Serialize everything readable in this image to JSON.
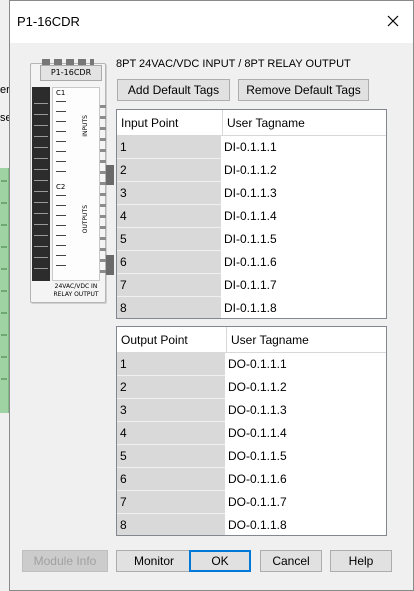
{
  "background": {
    "text1": "er",
    "text2": "se"
  },
  "dialog": {
    "title": "P1-16CDR"
  },
  "module_image": {
    "model": "P1-16CDR",
    "c1": "C1",
    "c2": "C2",
    "inputs_label": "INPUTS",
    "outputs_label": "OUTPUTS",
    "footer": "24VAC/VDC IN RELAY OUTPUT"
  },
  "description": "8PT 24VAC/VDC INPUT / 8PT RELAY OUTPUT",
  "toolbar": {
    "add_default_tags": "Add Default Tags",
    "remove_default_tags": "Remove Default Tags"
  },
  "input_table": {
    "headers": [
      "Input Point",
      "User Tagname"
    ],
    "rows": [
      [
        "1",
        "DI-0.1.1.1"
      ],
      [
        "2",
        "DI-0.1.1.2"
      ],
      [
        "3",
        "DI-0.1.1.3"
      ],
      [
        "4",
        "DI-0.1.1.4"
      ],
      [
        "5",
        "DI-0.1.1.5"
      ],
      [
        "6",
        "DI-0.1.1.6"
      ],
      [
        "7",
        "DI-0.1.1.7"
      ],
      [
        "8",
        "DI-0.1.1.8"
      ]
    ]
  },
  "output_table": {
    "headers": [
      "Output Point",
      "User Tagname"
    ],
    "rows": [
      [
        "1",
        "DO-0.1.1.1"
      ],
      [
        "2",
        "DO-0.1.1.2"
      ],
      [
        "3",
        "DO-0.1.1.3"
      ],
      [
        "4",
        "DO-0.1.1.4"
      ],
      [
        "5",
        "DO-0.1.1.5"
      ],
      [
        "6",
        "DO-0.1.1.6"
      ],
      [
        "7",
        "DO-0.1.1.7"
      ],
      [
        "8",
        "DO-0.1.1.8"
      ]
    ]
  },
  "buttons": {
    "module_info": "Module Info",
    "monitor": "Monitor",
    "ok": "OK",
    "cancel": "Cancel",
    "help": "Help"
  },
  "colors": {
    "default_button_border": "#0078d7",
    "point_cell_bg": "#d9d9d9",
    "client_bg": "#f0f0f0"
  }
}
